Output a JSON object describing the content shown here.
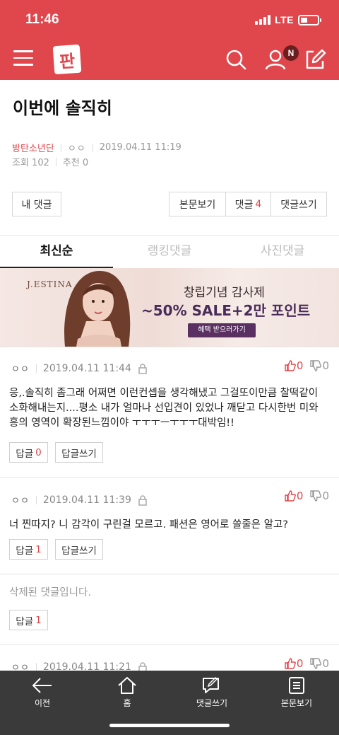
{
  "status": {
    "time": "11:46",
    "network": "LTE"
  },
  "header": {
    "logo_text": "판",
    "notification_badge": "N"
  },
  "post": {
    "title": "이번에 솔직히",
    "author": "방탄소년단",
    "nickname": "ㅇㅇ",
    "datetime": "2019.04.11 11:19",
    "views": "조회 102",
    "recommends": "추천 0"
  },
  "actions": {
    "my_comments": "내 댓글",
    "view_post": "본문보기",
    "comments_label": "댓글",
    "comments_count": "4",
    "write_comment": "댓글쓰기"
  },
  "tabs": [
    {
      "label": "최신순",
      "active": true
    },
    {
      "label": "랭킹댓글",
      "active": false
    },
    {
      "label": "사진댓글",
      "active": false
    }
  ],
  "banner": {
    "brand": "J.ESTINA",
    "line1": "창립기념 감사제",
    "line2": "~50% SALE+2만 포인트",
    "button": "혜택 받으러가기"
  },
  "comments": [
    {
      "nickname": "ㅇㅇ",
      "datetime": "2019.04.11 11:44",
      "likes": "0",
      "dislikes": "0",
      "body": "응,.솔직히 좀그래 어쩌면 이런컨셉을 생각해냈고 그걸또이만큼 찰떡같이 소화해내는지....평소 내가 얼마나 선입견이 있었나 깨닫고 다시한번 미와 흥의 영역이 확장된느낌이야 ㅜㅜㅜㅡㅜㅜㅜ대박임!!",
      "reply_label": "답글",
      "reply_count": "0",
      "write_reply": "답글쓰기"
    },
    {
      "nickname": "ㅇㅇ",
      "datetime": "2019.04.11 11:39",
      "likes": "0",
      "dislikes": "0",
      "body": "너 찐따지? 니 감각이 구린걸 모르고. 패션은 영어로 쓸줄은 알고?",
      "reply_label": "답글",
      "reply_count": "1",
      "write_reply": "답글쓰기"
    },
    {
      "body": "삭제된 댓글입니다.",
      "reply_label": "답글",
      "reply_count": "1"
    },
    {
      "nickname": "ㅇㅇ",
      "datetime": "2019.04.11 11:21",
      "likes": "0",
      "dislikes": "0"
    }
  ],
  "bottom_nav": [
    {
      "label": "이전",
      "icon": "back-arrow-icon"
    },
    {
      "label": "홈",
      "icon": "home-icon"
    },
    {
      "label": "댓글쓰기",
      "icon": "comment-write-icon"
    },
    {
      "label": "본문보기",
      "icon": "document-icon"
    }
  ],
  "colors": {
    "brand": "#e0474c",
    "nav_bg": "#3a3a3a",
    "banner_button": "#5a2f62"
  }
}
